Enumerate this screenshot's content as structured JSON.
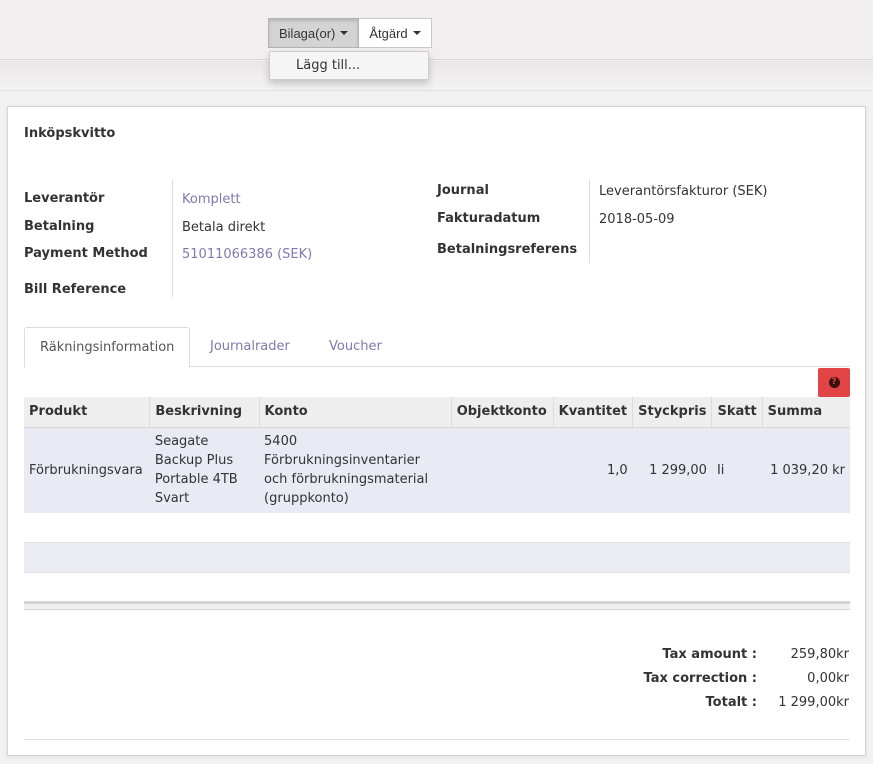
{
  "toolbar": {
    "attachments_label": "Bilaga(or)",
    "action_label": "Åtgärd",
    "dropdown_items": [
      "Lägg till..."
    ]
  },
  "form": {
    "title": "Inköpskvitto",
    "left_fields": [
      {
        "label": "Leverantör",
        "value": "Komplett"
      },
      {
        "label": "Betalning",
        "value": "Betala direkt"
      },
      {
        "label": "Payment Method",
        "value": "51011066386 (SEK)"
      },
      {
        "label": "Bill Reference",
        "value": ""
      }
    ],
    "right_fields": [
      {
        "label": "Journal",
        "value": "Leverantörsfakturor (SEK)"
      },
      {
        "label": "Fakturadatum",
        "value": "2018-05-09"
      },
      {
        "label": "Betalningsreferens",
        "value": ""
      }
    ]
  },
  "tabs": [
    "Räkningsinformation",
    "Journalrader",
    "Voucher"
  ],
  "help_button_glyph": "?",
  "table": {
    "columns": [
      "Produkt",
      "Beskrivning",
      "Konto",
      "Objektkonto",
      "Kvantitet",
      "Styckpris",
      "Skatt",
      "Summa"
    ],
    "rows": [
      {
        "produkt": "Förbrukningsvara",
        "beskrivning": [
          "Seagate",
          "Backup Plus",
          "Portable 4TB",
          "Svart"
        ],
        "konto": [
          "5400",
          "Förbrukningsinventarier",
          "och förbrukningsmaterial",
          "(gruppkonto)"
        ],
        "objektkonto": "",
        "kvantitet": "1,0",
        "styckpris": "1 299,00",
        "skatt": "Ii",
        "summa": "1 039,20 kr"
      }
    ]
  },
  "totals": [
    {
      "label": "Tax amount :",
      "value": "259,80kr"
    },
    {
      "label": "Tax correction :",
      "value": "0,00kr"
    },
    {
      "label": "Totalt :",
      "value": "1 299,00kr"
    }
  ],
  "colors": {
    "link": "#7c7bad",
    "row_highlight": "#e9eaf4",
    "help_button": "#e04444"
  }
}
